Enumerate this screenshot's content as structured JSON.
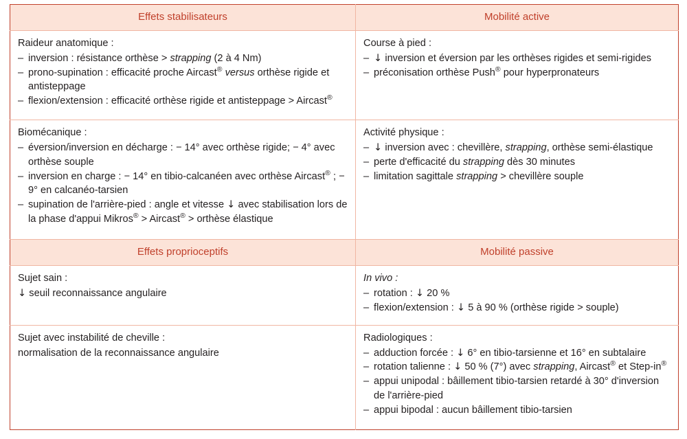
{
  "colors": {
    "outer_border": "#c0402b",
    "inner_border": "#f0b6a2",
    "header_bg": "#fce3d8",
    "header_text": "#c0402b",
    "body_text": "#231f20"
  },
  "table": {
    "sections": [
      {
        "header": {
          "left": "Effets stabilisateurs",
          "right": "Mobilité active"
        },
        "rows": [
          {
            "left": {
              "title": "Raideur anatomique :",
              "items": [
                "inversion : résistance orthèse > <i>strapping</i> (2 à 4 Nm)",
                "prono-supination : efficacité proche Aircast<sup class=\"reg\">®</sup> <i>versus</i> orthèse rigide et antisteppage",
                "flexion/extension : efficacité orthèse rigide et antisteppage > Aircast<sup class=\"reg\">®</sup>"
              ]
            },
            "right": {
              "title": "Course à pied :",
              "items": [
                "<span class=\"arrow-down\">↓</span> inversion et éversion par les orthèses rigides et semi-rigides",
                "préconisation orthèse Push<sup class=\"reg\">®</sup> pour hyperpronateurs"
              ]
            }
          },
          {
            "left": {
              "title": "Biomécanique :",
              "items": [
                "éversion/inversion en décharge : − 14° avec orthèse rigide; − 4° avec orthèse souple",
                "inversion en charge : − 14° en tibio-calcanéen avec orthèse Aircast<sup class=\"reg\">®</sup> ; − 9° en calcanéo-tarsien",
                "supination de l'arrière-pied : angle et vitesse <span class=\"arrow-down\">↓</span> avec stabilisation lors de la phase d'appui Mikros<sup class=\"reg\">®</sup> > Aircast<sup class=\"reg\">®</sup> > orthèse élastique"
              ]
            },
            "right": {
              "title": "Activité physique :",
              "items": [
                "<span class=\"arrow-down\">↓</span> inversion avec : chevillère, <i>strapping</i>, orthèse semi-élastique",
                "perte d'efficacité du <i>strapping</i> dès 30 minutes",
                "limitation sagittale <i>strapping</i> > chevillère souple"
              ]
            }
          }
        ]
      },
      {
        "header": {
          "left": "Effets proprioceptifs",
          "right": "Mobilité passive"
        },
        "rows": [
          {
            "left": {
              "title": "Sujet sain :",
              "lines": [
                "<span class=\"arrow-down\">↓</span> seuil reconnaissance angulaire"
              ]
            },
            "right": {
              "title": "In vivo :",
              "title_italic": true,
              "items": [
                "rotation : <span class=\"arrow-down\">↓</span> 20 %",
                "flexion/extension : <span class=\"arrow-down\">↓</span> 5 à 90 % (orthèse rigide > souple)"
              ]
            }
          },
          {
            "left": {
              "title": "Sujet avec instabilité de cheville :",
              "lines": [
                "normalisation de la reconnaissance angulaire"
              ]
            },
            "right": {
              "title": "Radiologiques :",
              "items": [
                "adduction forcée : <span class=\"arrow-down\">↓</span> 6° en tibio-tarsienne et 16° en subtalaire",
                "rotation talienne : <span class=\"arrow-down\">↓</span> 50 % (7°) avec <i>strapping</i>, Aircast<sup class=\"reg\">®</sup> et Step-in<sup class=\"reg\">®</sup>",
                "appui unipodal : bâillement tibio-tarsien retardé à 30° d'inversion de l'arrière-pied",
                "appui bipodal : aucun bâillement tibio-tarsien"
              ]
            }
          }
        ]
      }
    ]
  }
}
